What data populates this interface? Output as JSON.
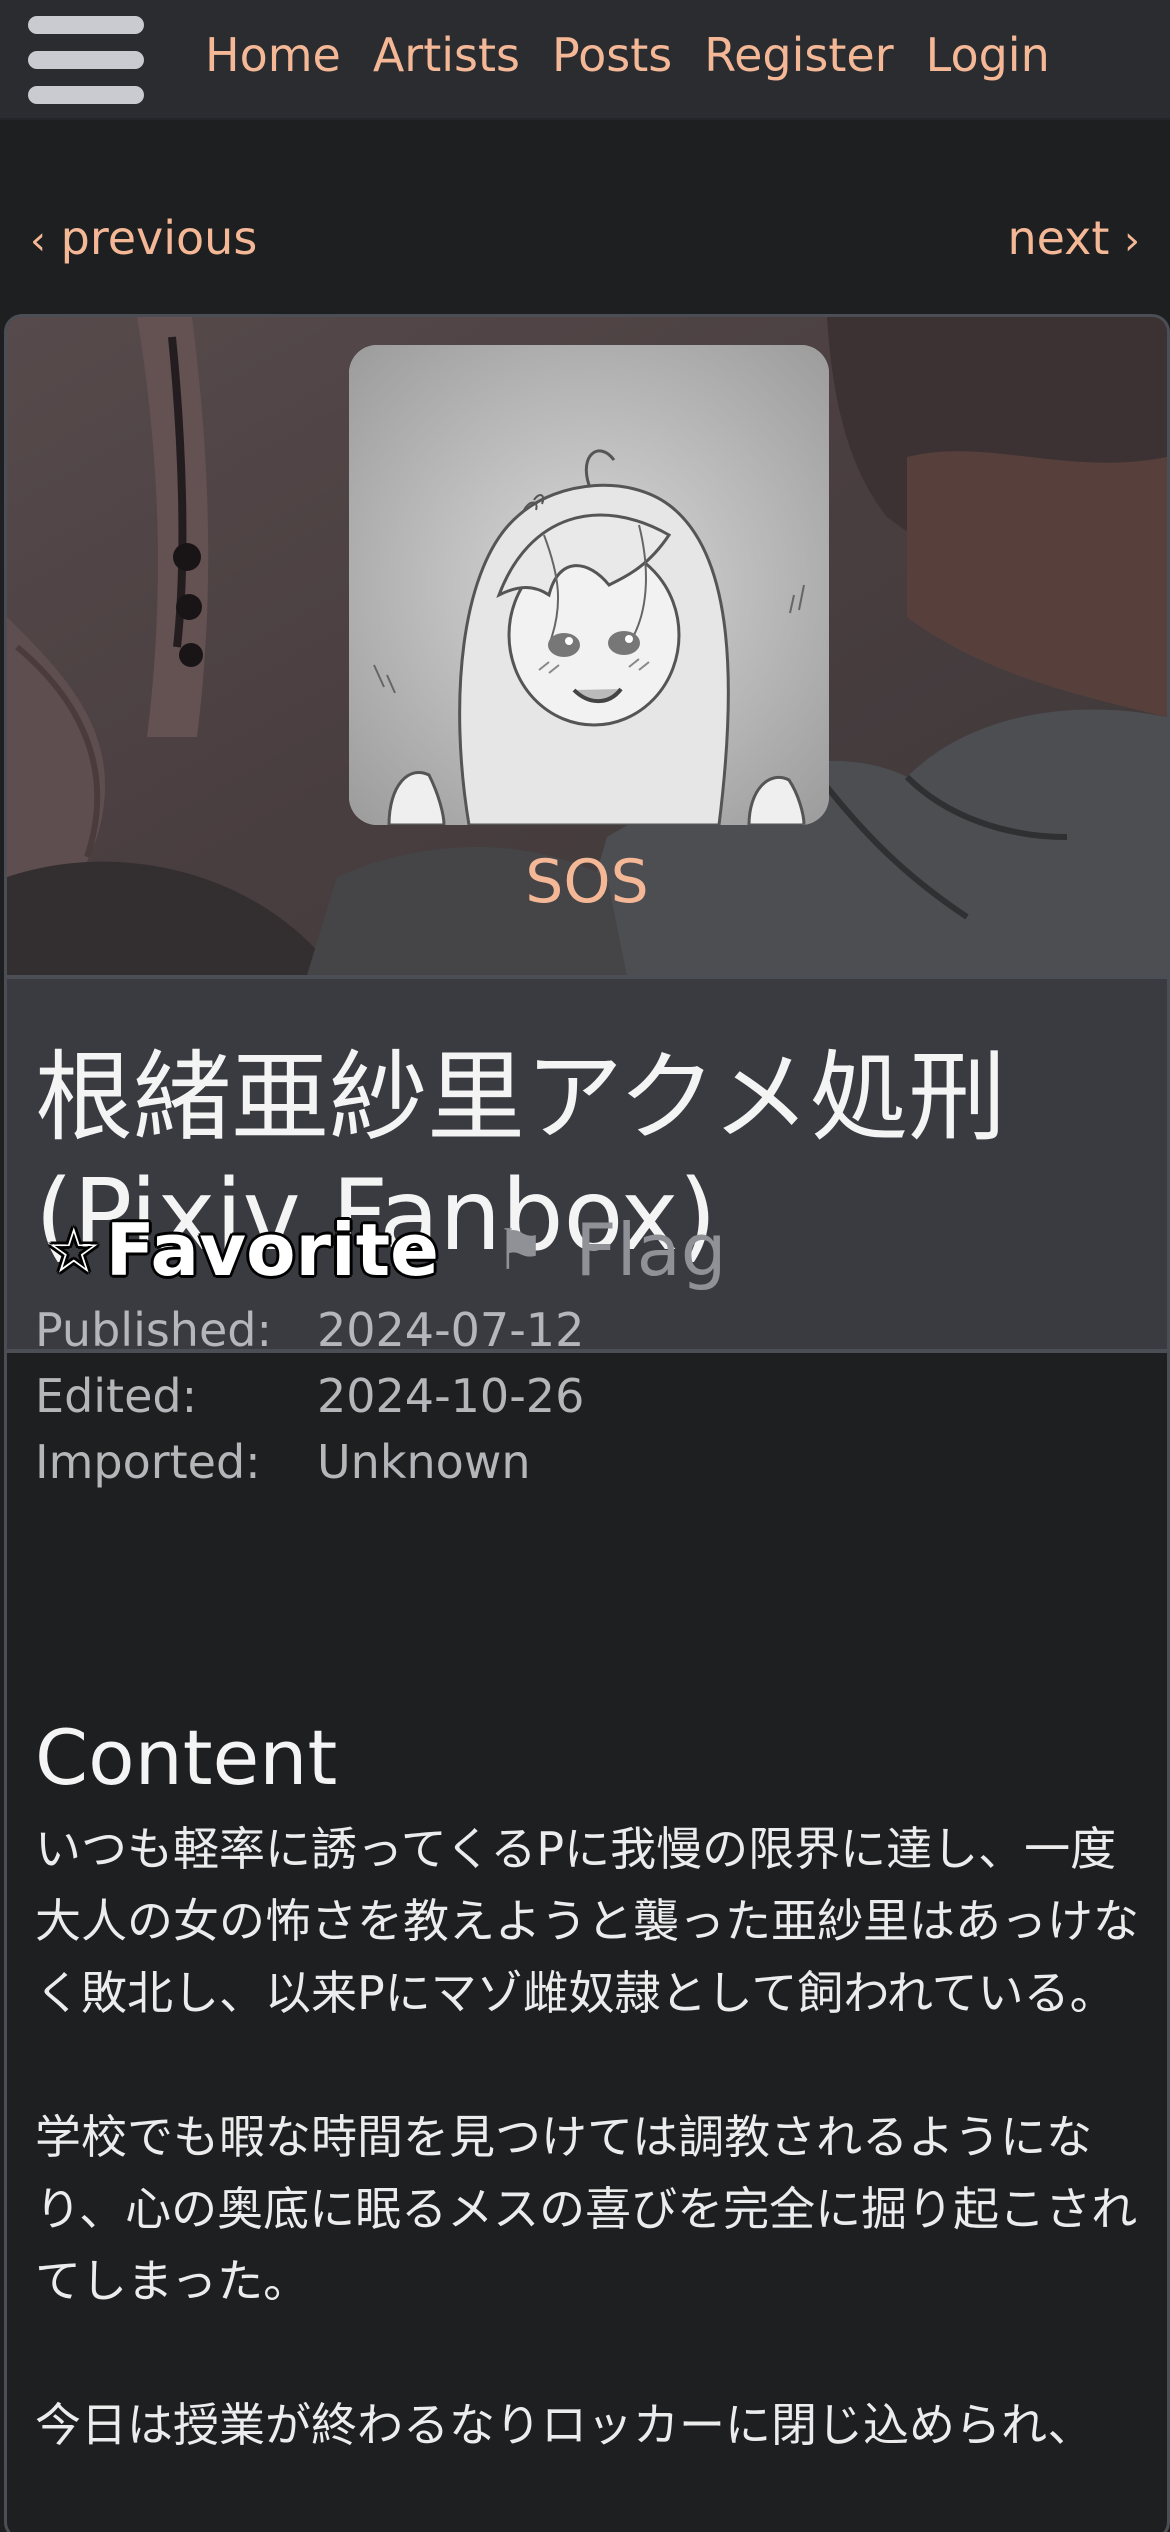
{
  "nav": {
    "menu_icon": "hamburger-menu-icon",
    "links": [
      "Home",
      "Artists",
      "Posts",
      "Register",
      "Login"
    ]
  },
  "pager": {
    "previous_icon": "chevron-left-icon",
    "previous_label": "previous",
    "next_label": "next",
    "next_icon": "chevron-right-icon"
  },
  "artist": {
    "name": "SOS",
    "avatar_icon": "artist-avatar-image"
  },
  "post": {
    "title": "根緒亜紗里アクメ処刑 (Pixiv Fanbox)",
    "meta": [
      {
        "label": "Published:",
        "value": "2024-07-12"
      },
      {
        "label": "Edited:",
        "value": "2024-10-26"
      },
      {
        "label": "Imported:",
        "value": "Unknown"
      }
    ],
    "favorite_label": "Favorite",
    "favorite_icon": "star-outline-icon",
    "flag_label": "Flag",
    "flag_icon": "flag-icon"
  },
  "content": {
    "heading": "Content",
    "paragraphs": [
      "いつも軽率に誘ってくるPに我慢の限界に達し、一度大人の女の怖さを教えようと襲った亜紗里はあっけなく敗北し、以来Pにマゾ雌奴隷として飼われている。",
      "学校でも暇な時間を見つけては調教されるようになり、心の奥底に眠るメスの喜びを完全に掘り起こされてしまった。",
      "今日は授業が終わるなりロッカーに閉じ込められ、"
    ]
  },
  "colors": {
    "accent_link": "#f5b897",
    "nav_background": "#2a2c30",
    "page_background": "#1e1f21",
    "info_background": "#393b41"
  }
}
